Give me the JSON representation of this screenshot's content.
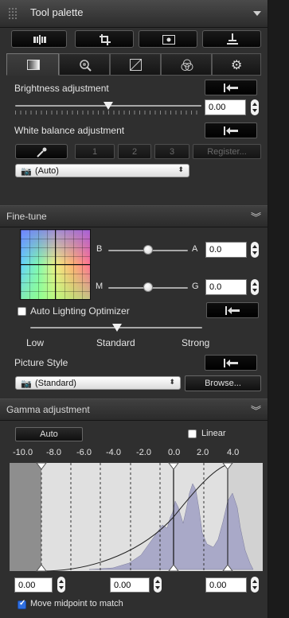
{
  "titlebar": {
    "title": "Tool palette"
  },
  "toolbar": {
    "icons": [
      "adjust-image-icon",
      "crop-icon",
      "dust-delete-icon",
      "stamp-icon"
    ]
  },
  "tabs": [
    {
      "icon": "basic-adjust-icon",
      "active": true
    },
    {
      "icon": "detail-zoom-icon",
      "active": false
    },
    {
      "icon": "tone-curve-icon",
      "active": false
    },
    {
      "icon": "color-adjust-icon",
      "active": false
    },
    {
      "icon": "settings-gear-icon",
      "active": false
    }
  ],
  "brightness": {
    "label": "Brightness adjustment",
    "value": "0.00",
    "level": 0.5
  },
  "white_balance": {
    "label": "White balance adjustment",
    "buttons": [
      "1",
      "2",
      "3"
    ],
    "register_label": "Register...",
    "selected": "(Auto)"
  },
  "fine_tune": {
    "header": "Fine-tune",
    "b_label": "B",
    "a_label": "A",
    "ba_value": "0.0",
    "m_label": "M",
    "g_label": "G",
    "mg_value": "0.0",
    "ba_level": 0.5,
    "mg_level": 0.5
  },
  "alo": {
    "label": "Auto Lighting Optimizer",
    "checked": false,
    "levels": [
      "Low",
      "Standard",
      "Strong"
    ],
    "selected": "Standard"
  },
  "picture_style": {
    "label": "Picture Style",
    "selected": "(Standard)",
    "browse_label": "Browse..."
  },
  "gamma": {
    "header": "Gamma adjustment",
    "auto_label": "Auto",
    "linear_label": "Linear",
    "linear_checked": false,
    "scale": [
      "-10.0",
      "-8.0",
      "-6.0",
      "-4.0",
      "-2.0",
      "0.0",
      "2.0",
      "4.0"
    ],
    "left_value": "0.00",
    "mid_value": "0.00",
    "right_value": "0.00",
    "move_midpoint_label": "Move midpoint to match",
    "move_midpoint_checked": true
  }
}
